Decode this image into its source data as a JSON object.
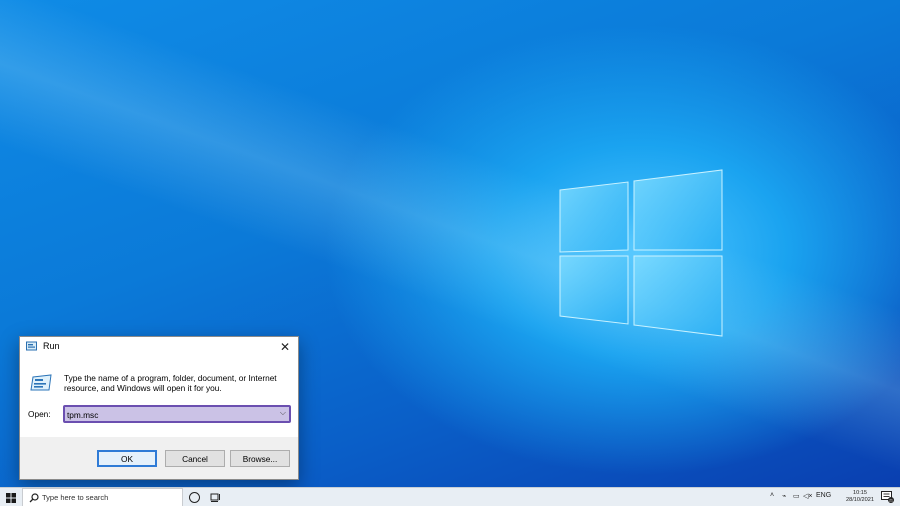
{
  "run_dialog": {
    "title": "Run",
    "description": "Type the name of a program, folder, document, or Internet resource, and Windows will open it for you.",
    "open_label": "Open:",
    "open_value": "tpm.msc",
    "ok_label": "OK",
    "cancel_label": "Cancel",
    "browse_label": "Browse...",
    "icons": {
      "title": "run-icon",
      "close": "close-icon",
      "body": "run-program-icon",
      "dropdown": "chevron-down-icon"
    }
  },
  "taskbar": {
    "search_placeholder": "Type here to search",
    "language": "ENG",
    "time": "10:15",
    "date": "28/10/2021",
    "notification_count": "21",
    "icons": [
      "windows-start-icon",
      "search-icon",
      "cortana-icon",
      "task-view-icon",
      "chevron-up-icon",
      "network-icon",
      "volume-icon",
      "action-center-icon"
    ]
  },
  "colors": {
    "desktop_blue": "#0b7ad8",
    "input_highlight": "#cbc2e6",
    "input_border": "#6b4fb0",
    "ok_border": "#2f7bd6"
  }
}
